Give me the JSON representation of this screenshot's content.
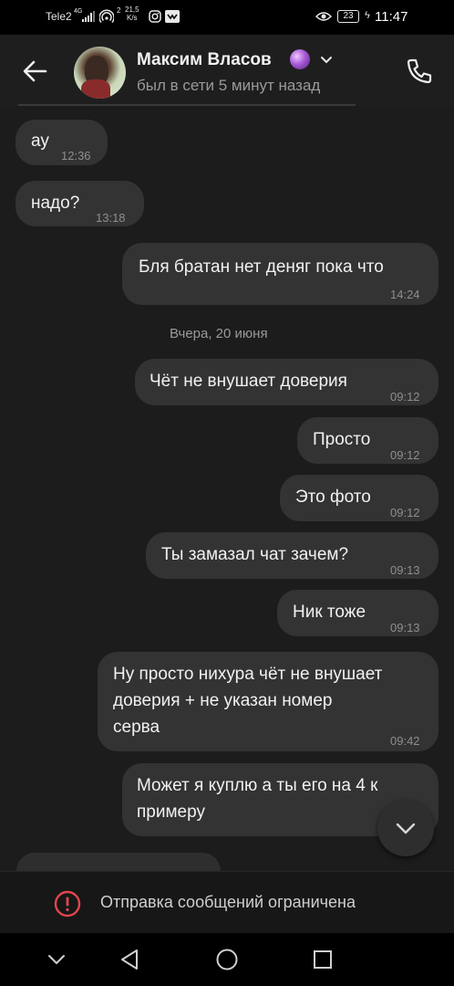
{
  "status_bar": {
    "carrier": "Tele2",
    "network": "4G",
    "sim_badge": "2",
    "speed_value": "21,5",
    "speed_unit": "K/s",
    "battery": "23",
    "time": "11:47"
  },
  "header": {
    "contact_name": "Максим Власов",
    "status": "был в сети 5 минут назад",
    "icons": [
      "back-arrow-icon",
      "crystal-ball-emoji",
      "chevron-down-icon",
      "phone-icon"
    ]
  },
  "messages": [
    {
      "text": "ау",
      "time": "12:36",
      "direction": "incoming"
    },
    {
      "text": "надо?",
      "time": "13:18",
      "direction": "incoming"
    },
    {
      "text": "Бля братан нет деняг пока что",
      "time": "14:24",
      "direction": "outgoing"
    },
    {
      "text": "Чёт не внушает доверия",
      "time": "09:12",
      "direction": "outgoing"
    },
    {
      "text": "Просто",
      "time": "09:12",
      "direction": "outgoing"
    },
    {
      "text": "Это фото",
      "time": "09:12",
      "direction": "outgoing"
    },
    {
      "text": "Ты замазал чат зачем?",
      "time": "09:13",
      "direction": "outgoing"
    },
    {
      "text": "Ник тоже",
      "time": "09:13",
      "direction": "outgoing"
    },
    {
      "lines": [
        "Ну просто нихура чёт не внушает",
        "доверия + не указан номер",
        "серва"
      ],
      "time": "09:42",
      "direction": "outgoing"
    },
    {
      "lines": [
        "Может я куплю а ты его на 4 к",
        "примеру"
      ],
      "direction": "outgoing"
    }
  ],
  "date_separator": "Вчера, 20 июня",
  "restriction": {
    "text": "Отправка сообщений ограничена",
    "color": "#e0474c"
  },
  "navigation": [
    "chevron-down-icon",
    "back-triangle-icon",
    "home-circle-icon",
    "recents-square-icon"
  ]
}
